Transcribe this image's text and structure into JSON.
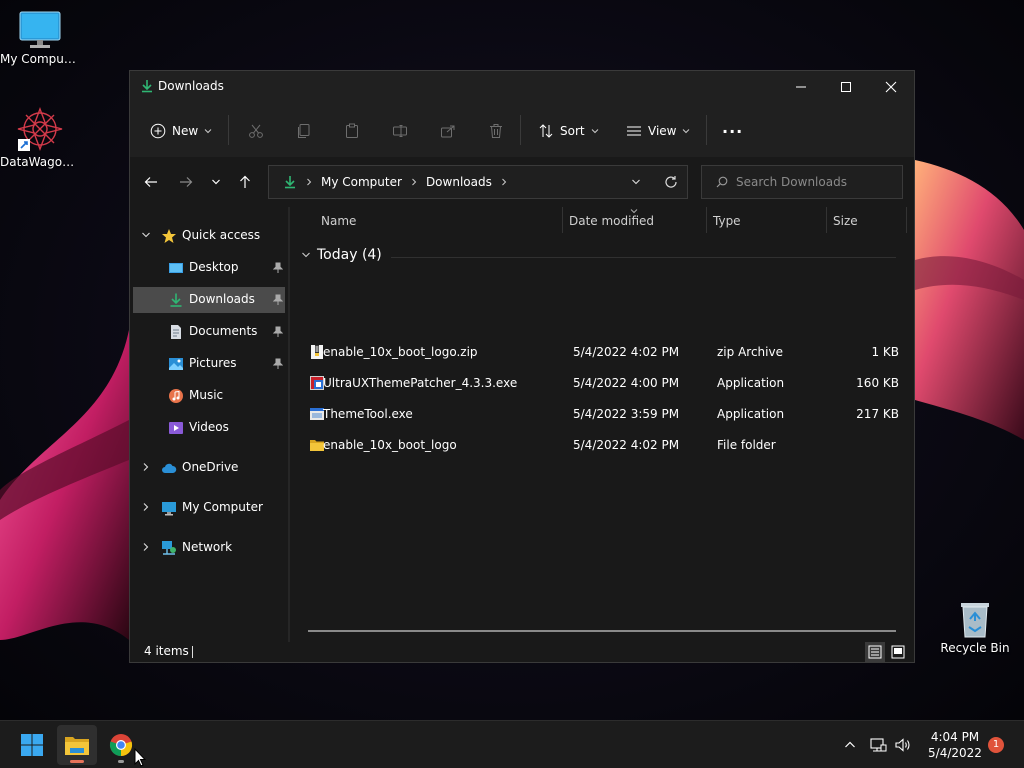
{
  "desktop": {
    "icons": [
      {
        "label": "My Computer"
      },
      {
        "label": "DataWagon..."
      },
      {
        "label": "Recycle Bin"
      }
    ]
  },
  "window": {
    "title": "Downloads"
  },
  "toolbar": {
    "new_label": "New",
    "sort_label": "Sort",
    "view_label": "View",
    "more_label": "···"
  },
  "address": {
    "crumbs": [
      "My Computer",
      "Downloads"
    ],
    "search_placeholder": "Search Downloads"
  },
  "nav": {
    "quick_access": "Quick access",
    "pinned": [
      {
        "label": "Desktop"
      },
      {
        "label": "Downloads"
      },
      {
        "label": "Documents"
      },
      {
        "label": "Pictures"
      },
      {
        "label": "Music"
      },
      {
        "label": "Videos"
      }
    ],
    "roots": [
      {
        "label": "OneDrive"
      },
      {
        "label": "My Computer"
      },
      {
        "label": "Network"
      }
    ]
  },
  "files": {
    "columns": {
      "name": "Name",
      "date": "Date modified",
      "type": "Type",
      "size": "Size"
    },
    "group": "Today (4)",
    "rows": [
      {
        "name": "enable_10x_boot_logo.zip",
        "date": "5/4/2022 4:02 PM",
        "type": "zip Archive",
        "size": "1 KB"
      },
      {
        "name": "UltraUXThemePatcher_4.3.3.exe",
        "date": "5/4/2022 4:00 PM",
        "type": "Application",
        "size": "160 KB"
      },
      {
        "name": "ThemeTool.exe",
        "date": "5/4/2022 3:59 PM",
        "type": "Application",
        "size": "217 KB"
      },
      {
        "name": "enable_10x_boot_logo",
        "date": "5/4/2022 4:02 PM",
        "type": "File folder",
        "size": ""
      }
    ]
  },
  "status": {
    "count": "4 items"
  },
  "taskbar": {
    "time": "4:04 PM",
    "date": "5/4/2022",
    "notifications": "1"
  },
  "colors": {
    "accent": "#0078d4",
    "download_green": "#2fb673",
    "folder_yellow": "#f3c53a",
    "badge_red": "#e0533b"
  }
}
